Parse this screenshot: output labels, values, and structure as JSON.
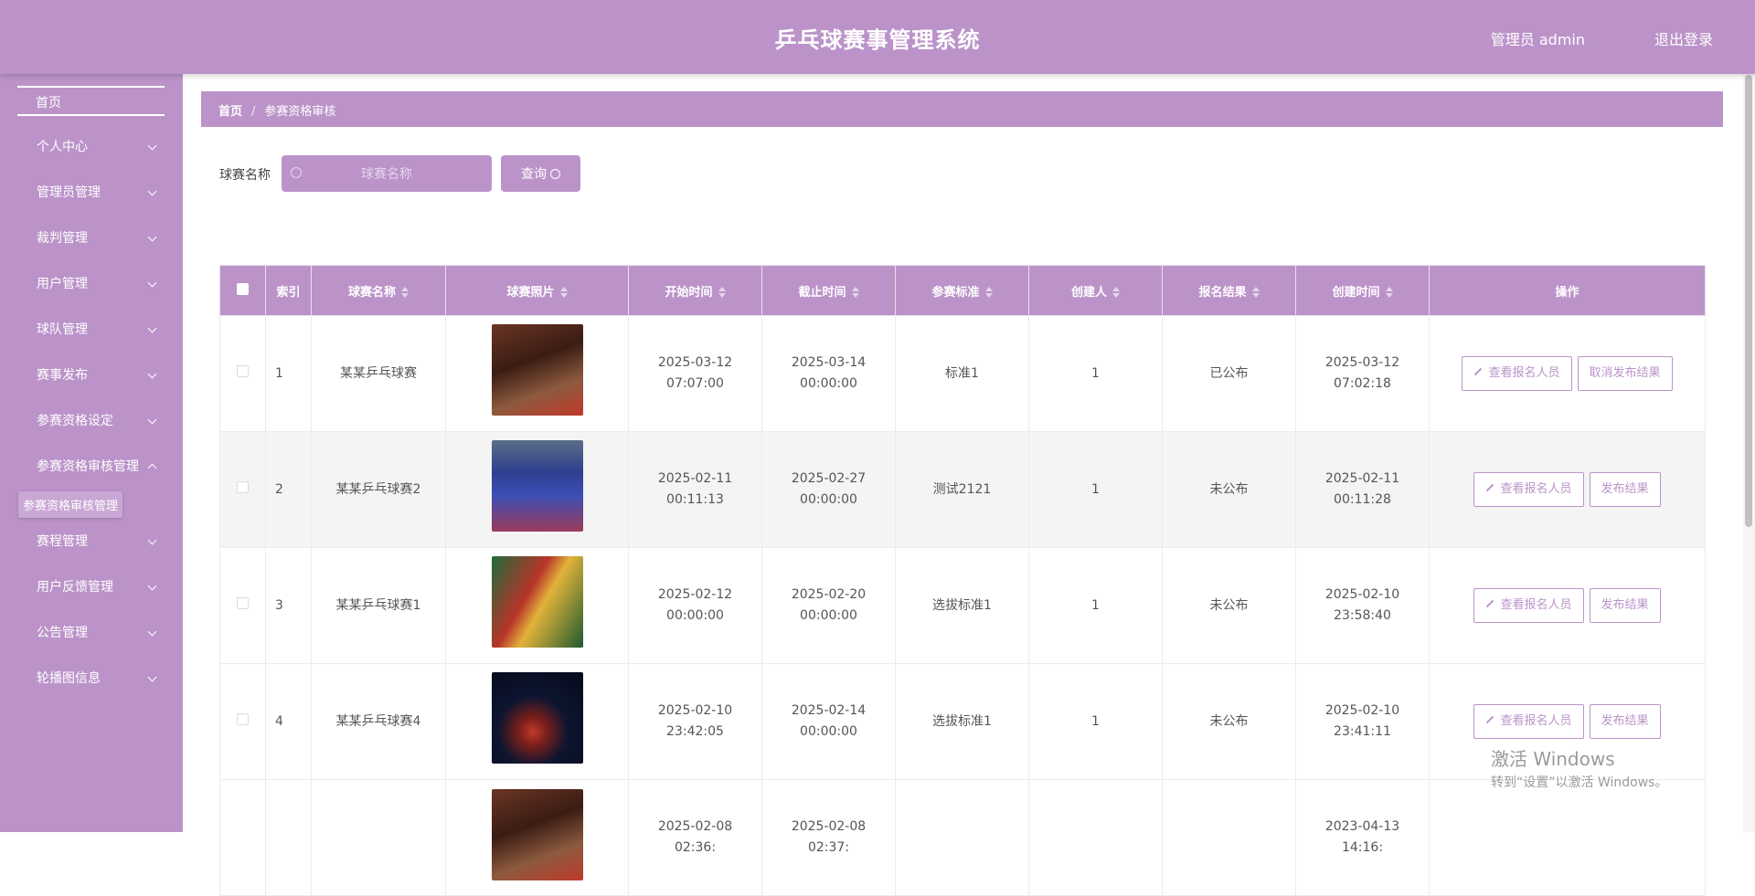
{
  "header": {
    "title": "乒乓球赛事管理系统",
    "user": "管理员 admin",
    "logout": "退出登录"
  },
  "sidebar": {
    "home": "首页",
    "items": [
      "个人中心",
      "管理员管理",
      "裁判管理",
      "用户管理",
      "球队管理",
      "赛事发布",
      "参赛资格设定",
      "参赛资格审核管理"
    ],
    "active_sub": "参赛资格审核管理",
    "items_after": [
      "赛程管理",
      "用户反馈管理",
      "公告管理",
      "轮播图信息"
    ]
  },
  "breadcrumb": {
    "home": "首页",
    "sep": "/",
    "current": "参赛资格审核"
  },
  "search": {
    "label": "球赛名称",
    "placeholder": "球赛名称",
    "button": "查询"
  },
  "table": {
    "headers": [
      "索引",
      "球赛名称",
      "球赛照片",
      "开始时间",
      "截止时间",
      "参赛标准",
      "创建人",
      "报名结果",
      "创建时间",
      "操作"
    ],
    "rows": [
      {
        "index": "1",
        "name": "某某乒乓球赛",
        "start": "2025-03-12 07:07:00",
        "end": "2025-03-14 00:00:00",
        "standard": "标准1",
        "creator": "1",
        "result": "已公布",
        "created": "2025-03-12 07:02:18",
        "btn1": "查看报名人员",
        "btn2": "取消发布结果"
      },
      {
        "index": "2",
        "name": "某某乒乓球赛2",
        "start": "2025-02-11 00:11:13",
        "end": "2025-02-27 00:00:00",
        "standard": "测试2121",
        "creator": "1",
        "result": "未公布",
        "created": "2025-02-11 00:11:28",
        "btn1": "查看报名人员",
        "btn2": "发布结果"
      },
      {
        "index": "3",
        "name": "某某乒乓球赛1",
        "start": "2025-02-12 00:00:00",
        "end": "2025-02-20 00:00:00",
        "standard": "选拔标准1",
        "creator": "1",
        "result": "未公布",
        "created": "2025-02-10 23:58:40",
        "btn1": "查看报名人员",
        "btn2": "发布结果"
      },
      {
        "index": "4",
        "name": "某某乒乓球赛4",
        "start": "2025-02-10 23:42:05",
        "end": "2025-02-14 00:00:00",
        "standard": "选拔标准1",
        "creator": "1",
        "result": "未公布",
        "created": "2025-02-10 23:41:11",
        "btn1": "查看报名人员",
        "btn2": "发布结果"
      },
      {
        "index": "",
        "name": "",
        "start": "2025-02-08 02:36:",
        "end": "2025-02-08 02:37:",
        "standard": "",
        "creator": "",
        "result": "",
        "created": "2023-04-13 14:16:",
        "btn1": "",
        "btn2": ""
      }
    ]
  },
  "watermark": {
    "line1": "激活 Windows",
    "line2": "转到“设置”以激活 Windows。"
  },
  "colors": {
    "accent": "#bb93c9",
    "row_alt": "#f4f4f4"
  }
}
